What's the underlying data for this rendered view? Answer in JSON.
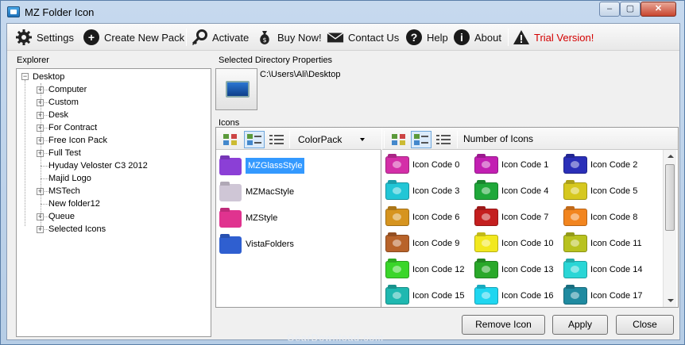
{
  "window": {
    "title": "MZ Folder Icon",
    "min_glyph": "–",
    "max_glyph": "▢",
    "close_glyph": "✕"
  },
  "toolbar": {
    "settings": "Settings",
    "create_new_pack": "Create New Pack",
    "activate": "Activate",
    "buy_now": "Buy Now!",
    "contact_us": "Contact Us",
    "help": "Help",
    "about": "About",
    "trial": "Trial Version!"
  },
  "explorer": {
    "label": "Explorer",
    "root": "Desktop",
    "items": [
      {
        "label": "Computer",
        "expandable": true
      },
      {
        "label": "Custom",
        "expandable": true
      },
      {
        "label": "Desk",
        "expandable": true
      },
      {
        "label": "For Contract",
        "expandable": true
      },
      {
        "label": "Free Icon Pack",
        "expandable": true
      },
      {
        "label": "Full Test",
        "expandable": true
      },
      {
        "label": "Hyuday Veloster C3 2012",
        "expandable": false
      },
      {
        "label": "Majid Logo",
        "expandable": false
      },
      {
        "label": "MSTech",
        "expandable": true
      },
      {
        "label": "New folder12",
        "expandable": false
      },
      {
        "label": "Queue",
        "expandable": true
      },
      {
        "label": "Selected Icons",
        "expandable": true
      }
    ]
  },
  "directory": {
    "label": "Selected Directory Properties",
    "path": "C:\\Users\\Ali\\Desktop"
  },
  "icons": {
    "label": "Icons",
    "combo_value": "ColorPack",
    "number_label": "Number of Icons",
    "packs": [
      {
        "label": "MZGlassStyle",
        "color": "#8b3fd6",
        "selected": true
      },
      {
        "label": "MZMacStyle",
        "color": "#cfc6d6",
        "selected": false
      },
      {
        "label": "MZStyle",
        "color": "#e0338f",
        "selected": false
      },
      {
        "label": "VistaFolders",
        "color": "#2f5fd0",
        "selected": false
      }
    ],
    "codes": [
      {
        "label": "Icon Code 0",
        "color": "#d42fa8"
      },
      {
        "label": "Icon Code 1",
        "color": "#c21fb2"
      },
      {
        "label": "Icon Code 2",
        "color": "#2a2fb8"
      },
      {
        "label": "Icon Code 3",
        "color": "#22c6d6"
      },
      {
        "label": "Icon Code 4",
        "color": "#1fa83a"
      },
      {
        "label": "Icon Code 5",
        "color": "#d6c81f"
      },
      {
        "label": "Icon Code 6",
        "color": "#d6941f"
      },
      {
        "label": "Icon Code 7",
        "color": "#c41f1f"
      },
      {
        "label": "Icon Code 8",
        "color": "#f2851f"
      },
      {
        "label": "Icon Code 9",
        "color": "#b8632a"
      },
      {
        "label": "Icon Code 10",
        "color": "#f2e81f"
      },
      {
        "label": "Icon Code 11",
        "color": "#b8c21f"
      },
      {
        "label": "Icon Code 12",
        "color": "#3ad62a"
      },
      {
        "label": "Icon Code 13",
        "color": "#2aa82a"
      },
      {
        "label": "Icon Code 14",
        "color": "#2ad6d6"
      },
      {
        "label": "Icon Code 15",
        "color": "#1fb8b0"
      },
      {
        "label": "Icon Code 16",
        "color": "#1fd6f0"
      },
      {
        "label": "Icon Code 17",
        "color": "#1f8aa0"
      }
    ]
  },
  "buttons": {
    "remove_icon": "Remove Icon",
    "apply": "Apply",
    "close": "Close"
  },
  "watermark": "GearDownload.com"
}
